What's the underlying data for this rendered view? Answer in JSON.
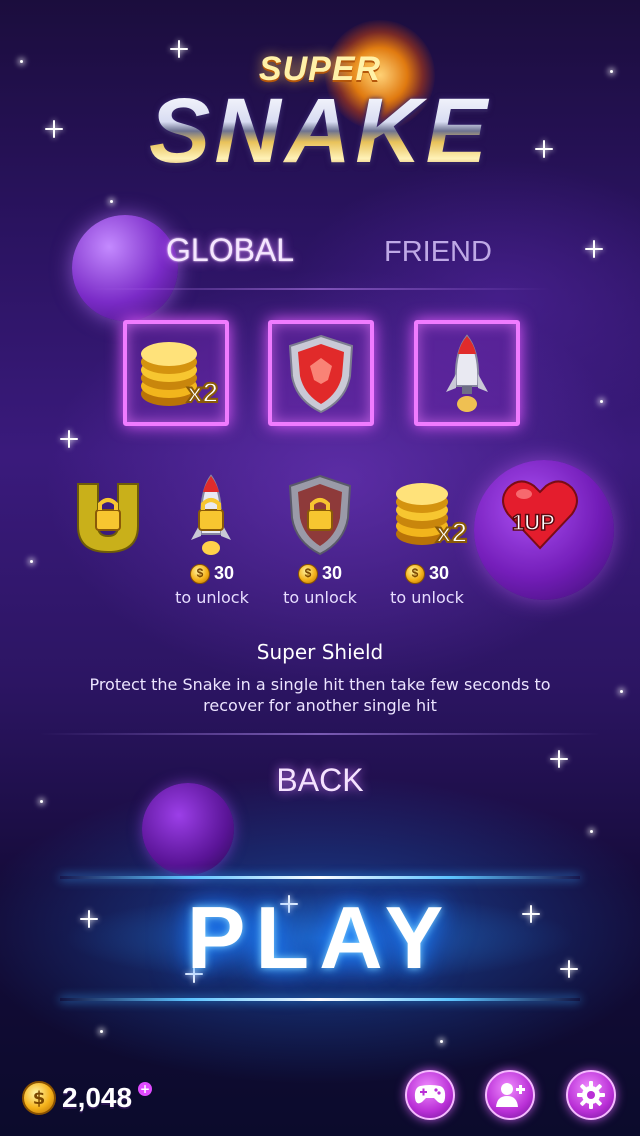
{
  "logo": {
    "super": "SUPER",
    "snake": "SNAKE"
  },
  "tabs": [
    {
      "label": "GLOBAL",
      "active": true
    },
    {
      "label": "FRIEND",
      "active": false
    }
  ],
  "selected_slots": [
    {
      "icon": "coin-x2-icon",
      "badge": "x2"
    },
    {
      "icon": "shield-icon"
    },
    {
      "icon": "rocket-icon"
    }
  ],
  "powerups": [
    {
      "icon": "magnet-icon",
      "locked": true
    },
    {
      "icon": "rocket-icon",
      "locked": true,
      "cost": "30",
      "unlock_label": "to unlock"
    },
    {
      "icon": "shield-icon",
      "locked": true,
      "cost": "30",
      "unlock_label": "to unlock"
    },
    {
      "icon": "coin-x2-icon",
      "badge": "x2",
      "locked": false,
      "cost": "30",
      "unlock_label": "to unlock"
    },
    {
      "icon": "heart-icon",
      "badge": "1UP",
      "locked": false
    }
  ],
  "description": {
    "title": "Super Shield",
    "text": "Protect the Snake in a single hit then take few seconds to recover for another single hit"
  },
  "back_label": "BACK",
  "play_label": "PLAY",
  "wallet": {
    "coins": "2,048",
    "plus": "+"
  },
  "bottom_buttons": [
    {
      "icon": "gamepad-icon"
    },
    {
      "icon": "add-friend-icon"
    },
    {
      "icon": "gear-icon"
    }
  ],
  "colors": {
    "accent_pink": "#f07bff",
    "play_glow": "#1f8bff",
    "coin_gold": "#f5b21a"
  }
}
